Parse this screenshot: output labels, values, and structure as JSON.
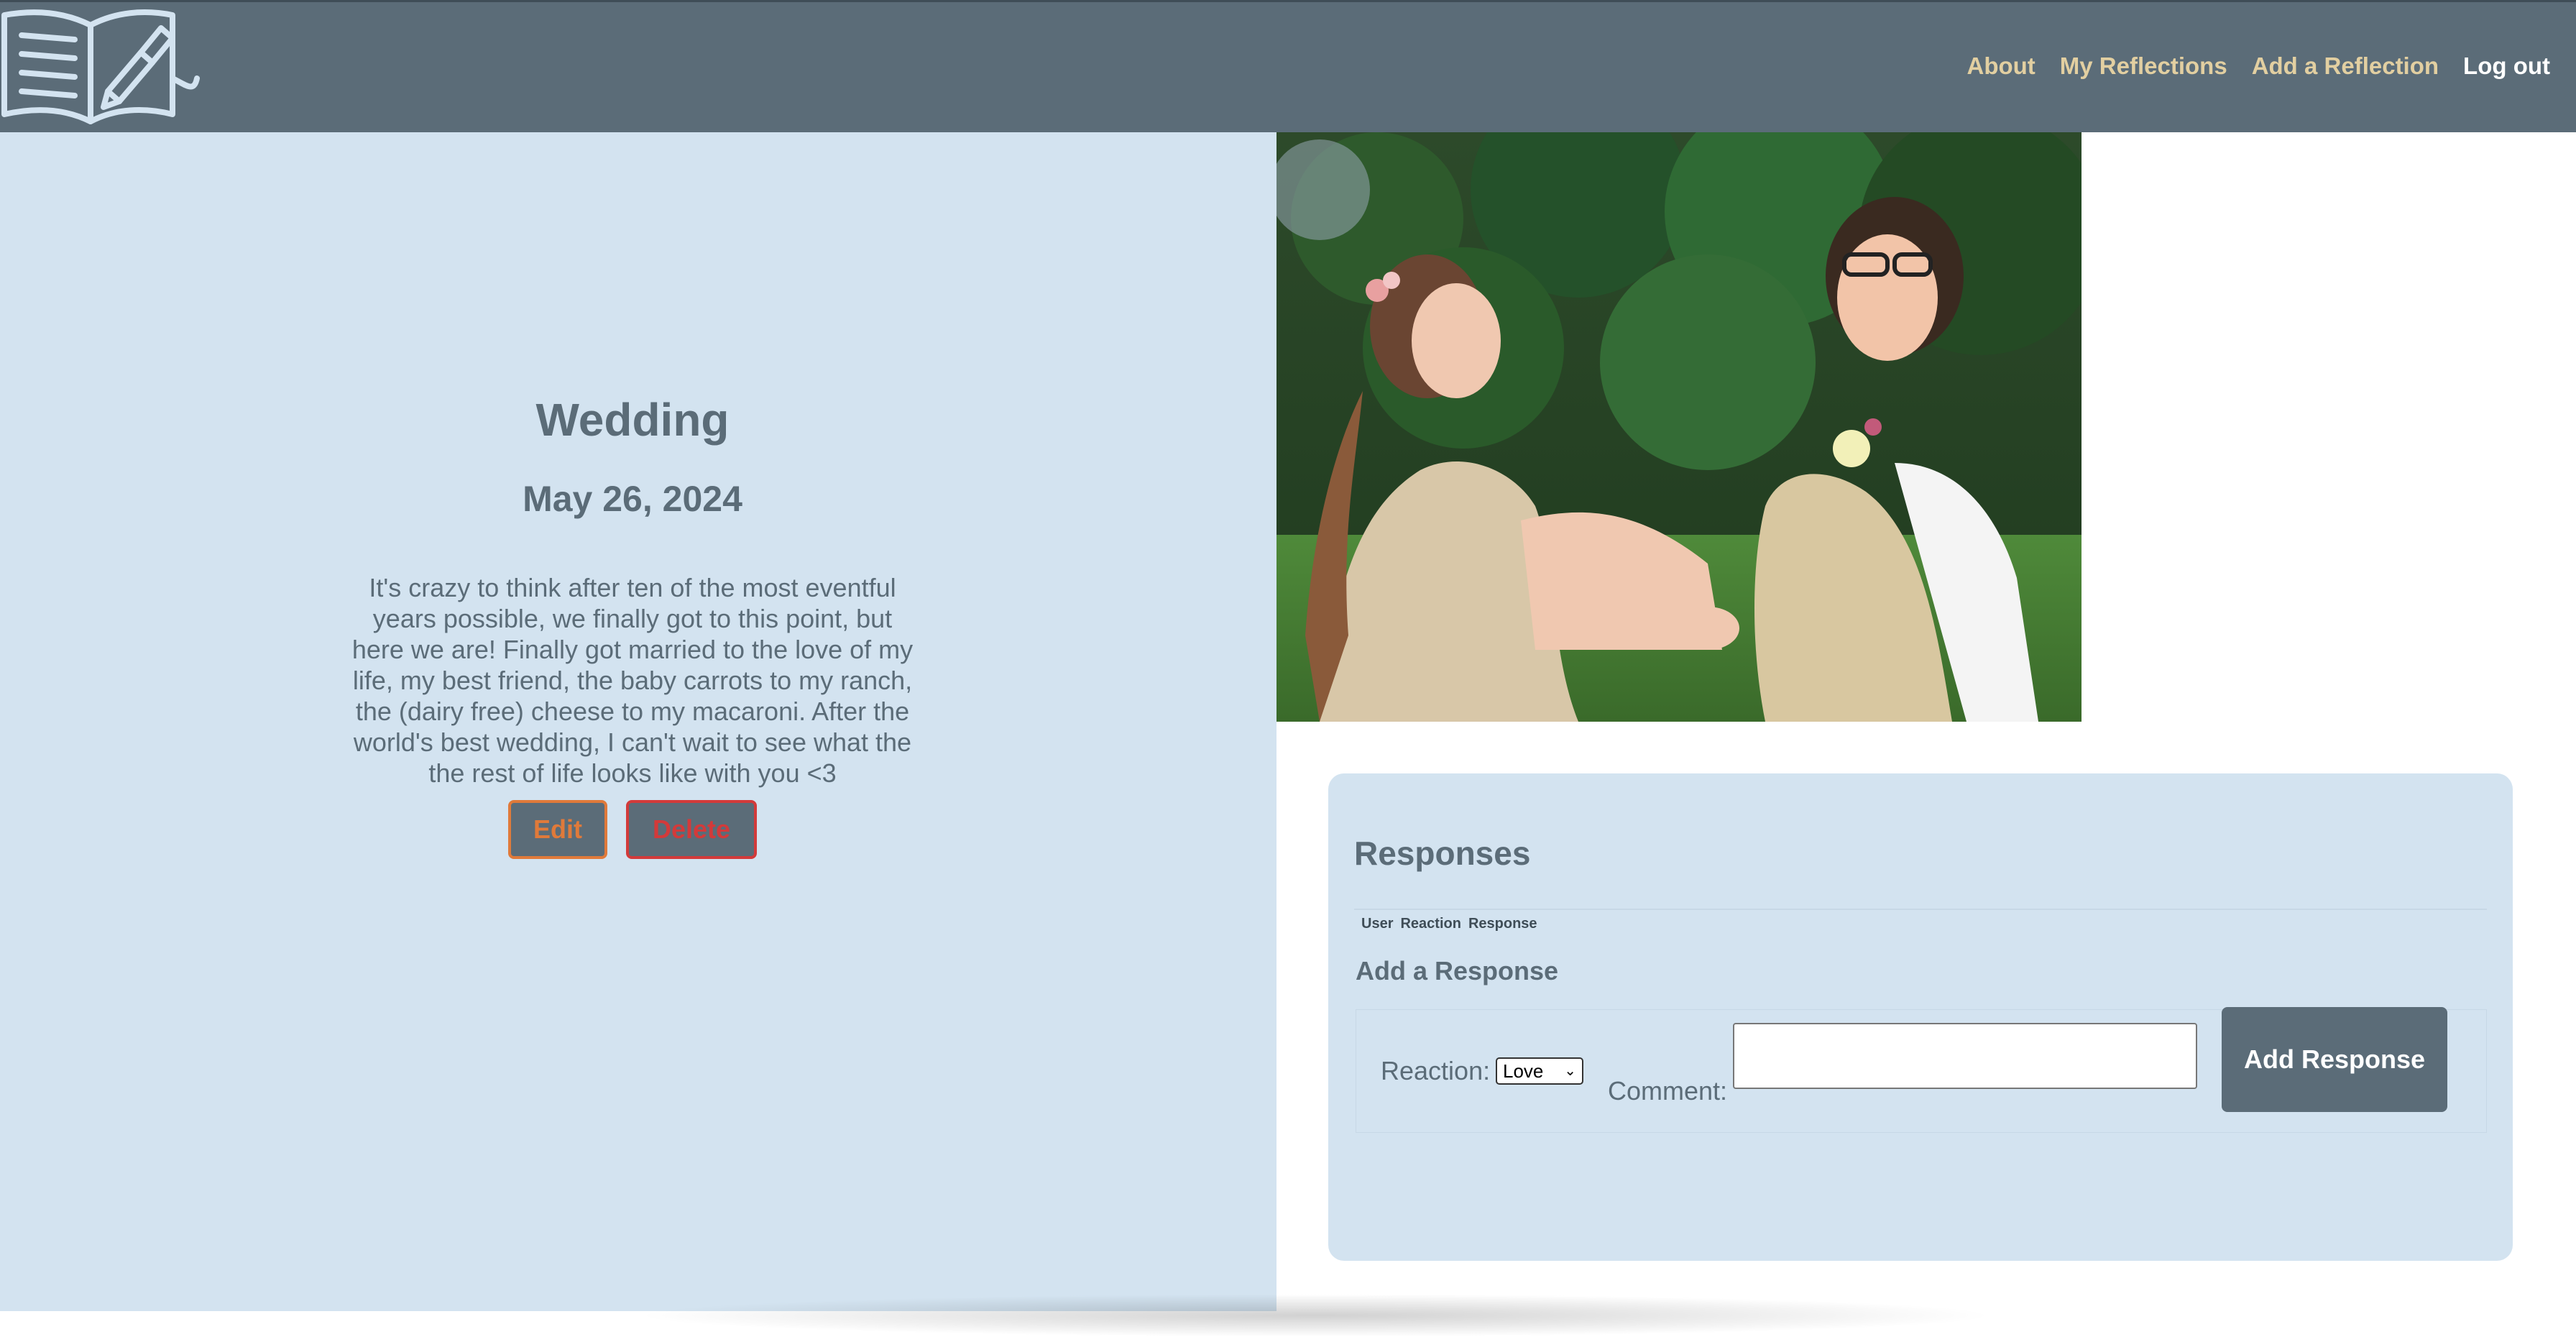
{
  "nav": {
    "logo_icon": "book-pen-logo-icon",
    "links": [
      "About",
      "My Reflections",
      "Add a Reflection"
    ],
    "logout": "Log out"
  },
  "reflection": {
    "title": "Wedding",
    "date": "May 26, 2024",
    "body": "It's crazy to think after ten of the most eventful years possible, we finally got to this point, but here we are! Finally got married to the love of my life, my best friend, the baby carrots to my ranch, the (dairy free) cheese to my macaroni. After the world's best wedding, I can't wait to see what the the rest of life looks like with you <3",
    "edit_label": "Edit",
    "delete_label": "Delete"
  },
  "photo": {
    "alt_icon": "wedding-photo"
  },
  "responses": {
    "title": "Responses",
    "columns": [
      "User",
      "Reaction",
      "Response"
    ],
    "add_title": "Add a Response",
    "reaction_label": "Reaction:",
    "reaction_value": "Love",
    "comment_label": "Comment:",
    "comment_value": "",
    "submit_label": "Add Response"
  },
  "colors": {
    "nav_bg": "#5b6c78",
    "nav_link": "#e2cfa1",
    "panel_bg": "#d3e3f0",
    "edit": "#e07a3a",
    "delete": "#d33a3a"
  }
}
